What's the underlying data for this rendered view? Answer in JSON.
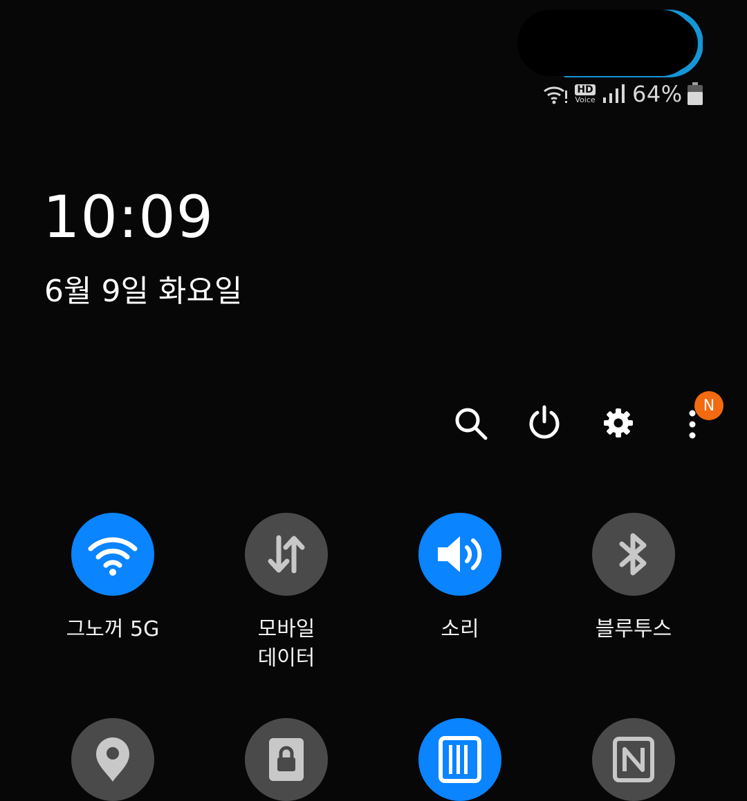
{
  "status_bar": {
    "battery_percent": "64%",
    "hd_label": "HD",
    "voice_label": "Voice",
    "icons": [
      "wifi-icon",
      "hd-voice-icon",
      "signal-icon",
      "battery-icon"
    ]
  },
  "clock": {
    "time": "10:09",
    "date": "6월 9일 화요일"
  },
  "header_actions": {
    "items": [
      "search-icon",
      "power-icon",
      "gear-icon",
      "more-vert-icon"
    ],
    "notification_badge": "N"
  },
  "quick_tiles": [
    {
      "label": "그노꺼 5G",
      "icon": "wifi-icon",
      "active": true
    },
    {
      "label": "모바일\n데이터",
      "icon": "mobile-data-icon",
      "active": false
    },
    {
      "label": "소리",
      "icon": "sound-icon",
      "active": true
    },
    {
      "label": "블루투스",
      "icon": "bluetooth-icon",
      "active": false
    },
    {
      "label": "",
      "icon": "location-icon",
      "active": false
    },
    {
      "label": "",
      "icon": "secure-folder-icon",
      "active": false
    },
    {
      "label": "",
      "icon": "barcode-icon",
      "active": true
    },
    {
      "label": "",
      "icon": "nfc-icon",
      "active": false
    }
  ],
  "colors": {
    "background": "#070707",
    "tile_active": "#0a84ff",
    "tile_inactive": "#4a4a4a",
    "badge": "#f36a10",
    "camera_ring": "#1596d6"
  }
}
